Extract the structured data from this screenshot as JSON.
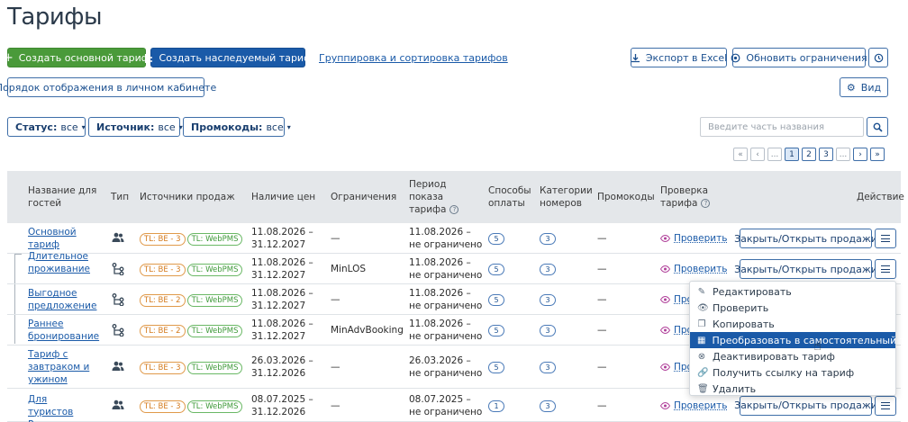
{
  "title": "Тарифы",
  "toolbar": {
    "create_main": "Создать основной тариф",
    "create_inherited": "Создать наследуемый тариф",
    "grouping_link": "Группировка и сортировка тарифов",
    "export": "Экспорт в Excel",
    "refresh_limits": "Обновить ограничения",
    "display_order": "Порядок отображения в личном кабинете",
    "view": "Вид"
  },
  "filters": {
    "status_label": "Статус:",
    "status_value": "все",
    "source_label": "Источник:",
    "source_value": "все",
    "promo_label": "Промокоды:",
    "promo_value": "все"
  },
  "search": {
    "placeholder": "Введите часть названия"
  },
  "pager": {
    "pages": [
      "1",
      "2",
      "3"
    ],
    "ellipsis": "...",
    "current": "1"
  },
  "columns": {
    "name": "Название для гостей",
    "type": "Тип",
    "sources": "Источники продаж",
    "prices": "Наличие цен",
    "limits": "Ограничения",
    "period": "Период показа тарифа",
    "payment": "Способы оплаты",
    "categories": "Категории номеров",
    "promo": "Промокоды",
    "check": "Проверка тарифа",
    "action": "Действие"
  },
  "rows": [
    {
      "name": "Основной тариф",
      "type_icon": "users-icon",
      "be": "TL: BE - 3",
      "web": "TL: WebPMS",
      "price_from": "11.08.2026 –",
      "price_to": "31.12.2027",
      "limits": "—",
      "period_from": "11.08.2026 –",
      "period_to": "не ограничено",
      "payment": "5",
      "categories": "3",
      "promo": "—",
      "check": "Проверить"
    },
    {
      "name": "Длительное проживание",
      "type_icon": "hierarchy-icon",
      "be": "TL: BE - 3",
      "web": "TL: WebPMS",
      "price_from": "11.08.2026 –",
      "price_to": "31.12.2027",
      "limits": "MinLOS",
      "period_from": "11.08.2026 –",
      "period_to": "не ограничено",
      "payment": "5",
      "categories": "3",
      "promo": "—",
      "check": "Проверить"
    },
    {
      "name": "Выгодное предложение",
      "type_icon": "hierarchy-icon",
      "be": "TL: BE - 2",
      "web": "TL: WebPMS",
      "price_from": "11.08.2026 –",
      "price_to": "31.12.2027",
      "limits": "—",
      "period_from": "11.08.2026 –",
      "period_to": "не ограничено",
      "payment": "5",
      "categories": "3",
      "promo": "—",
      "check": "Про"
    },
    {
      "name": "Раннее бронирование",
      "type_icon": "hierarchy-icon",
      "be": "TL: BE - 2",
      "web": "TL: WebPMS",
      "price_from": "11.08.2026 –",
      "price_to": "31.12.2027",
      "limits": "MinAdvBooking",
      "period_from": "11.08.2026 –",
      "period_to": "не ограничено",
      "payment": "5",
      "categories": "3",
      "promo": "—",
      "check": "Про"
    },
    {
      "name": "Тариф с завтраком и ужином",
      "type_icon": "users-icon",
      "be": "TL: BE - 3",
      "web": "TL: WebPMS",
      "price_from": "26.03.2026 –",
      "price_to": "31.12.2026",
      "limits": "—",
      "period_from": "26.03.2026 –",
      "period_to": "не ограничено",
      "payment": "5",
      "categories": "3",
      "promo": "—",
      "check": "Про"
    },
    {
      "name": "Для туристов России",
      "type_icon": "users-icon",
      "be": "TL: BE - 3",
      "web": "TL: WebPMS",
      "price_from": "08.07.2025 –",
      "price_to": "31.12.2026",
      "limits": "—",
      "period_from": "08.07.2025 –",
      "period_to": "не ограничено",
      "payment": "1",
      "categories": "3",
      "promo": "—",
      "check": "Проверить"
    }
  ],
  "row_action": "Закрыть/Открыть продажи",
  "context_menu": {
    "items": [
      {
        "label": "Редактировать",
        "icon": "pencil-icon"
      },
      {
        "label": "Проверить",
        "icon": "eye-icon"
      },
      {
        "label": "Копировать",
        "icon": "copy-icon"
      },
      {
        "label": "Преобразовать в самостоятельный тариф",
        "icon": "calendar-icon",
        "highlighted": true
      },
      {
        "label": "Деактивировать тариф",
        "icon": "cancel-circle-icon"
      },
      {
        "label": "Получить ссылку на тариф",
        "icon": "link-icon"
      },
      {
        "label": "Удалить",
        "icon": "trash-icon"
      }
    ]
  },
  "colors": {
    "primary": "#1a5aa8",
    "green": "#4a9a3a",
    "orange": "#d47a1c",
    "badge_green": "#3f9a3a"
  }
}
